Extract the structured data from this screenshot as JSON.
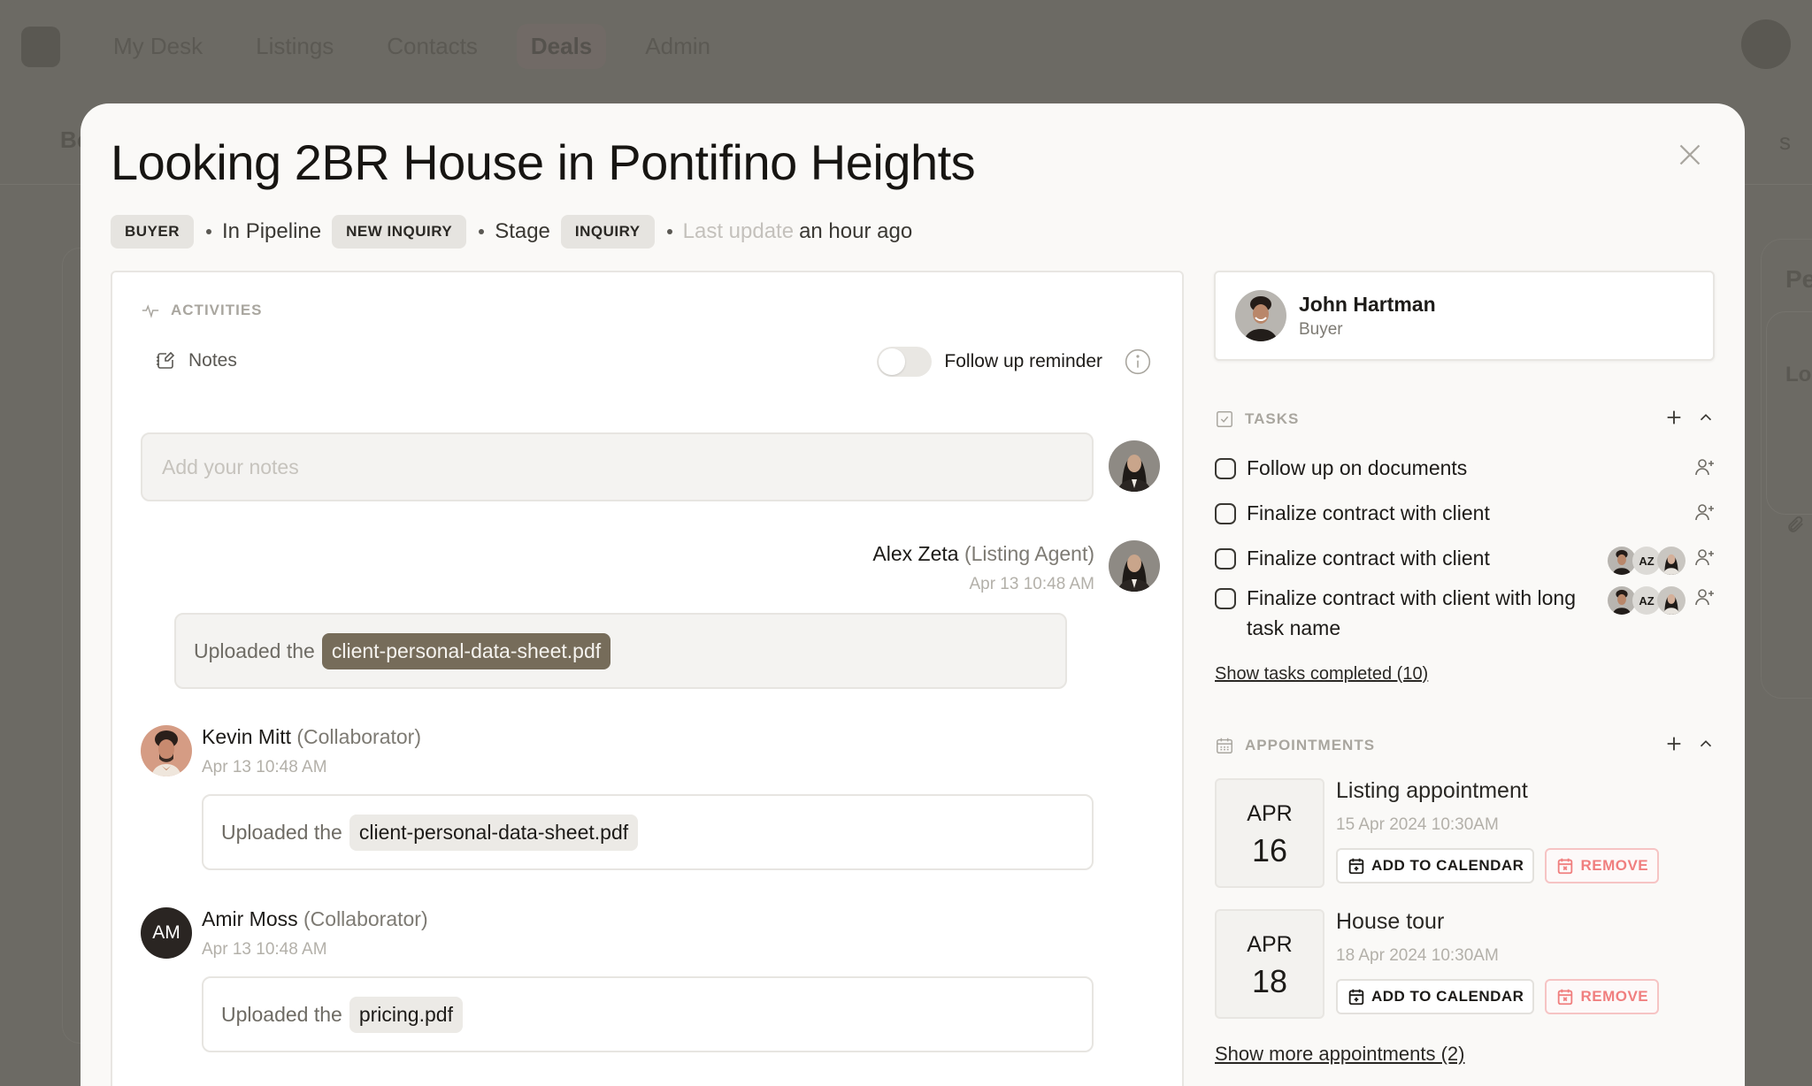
{
  "background_app": {
    "nav_items": [
      {
        "label": "My Desk",
        "active": false
      },
      {
        "label": "Listings",
        "active": false
      },
      {
        "label": "Contacts",
        "active": false
      },
      {
        "label": "Deals",
        "active": true
      },
      {
        "label": "Admin",
        "active": false
      }
    ],
    "subbar_left": "Bo",
    "subbar_right": "s",
    "right_panel_title": "Pe",
    "right_panel_sub": "Lo"
  },
  "modal": {
    "title": "Looking 2BR House in Pontifino Heights",
    "meta": {
      "type_chip": "BUYER",
      "pipeline_label": "In Pipeline",
      "pipeline_chip": "NEW INQUIRY",
      "stage_label": "Stage",
      "stage_chip": "INQUIRY",
      "last_update_label": "Last update",
      "last_update_value": "an hour ago"
    }
  },
  "activities": {
    "heading": "ACTIVITIES",
    "notes_label": "Notes",
    "follow_up_label": "Follow up reminder",
    "follow_up_enabled": false,
    "notes_placeholder": "Add your notes",
    "notes_value": "",
    "feed": [
      {
        "author": "Alex Zeta",
        "role": "(Listing Agent)",
        "time": "Apr 13 10:48 AM",
        "prefix": "Uploaded the",
        "file": "client-personal-data-sheet.pdf",
        "own": true
      },
      {
        "author": "Kevin Mitt",
        "role": "(Collaborator)",
        "time": "Apr 13 10:48 AM",
        "prefix": "Uploaded the",
        "file": "client-personal-data-sheet.pdf",
        "own": false
      },
      {
        "author": "Amir Moss",
        "role": "(Collaborator)",
        "time": "Apr 13 10:48 AM",
        "prefix": "Uploaded the",
        "file": "pricing.pdf",
        "own": false,
        "initials": "AM"
      }
    ]
  },
  "contact": {
    "name": "John Hartman",
    "role": "Buyer"
  },
  "tasks": {
    "heading": "TASKS",
    "items": [
      {
        "label": "Follow up on documents",
        "done": false,
        "assignees": []
      },
      {
        "label": "Finalize contract with client",
        "done": false,
        "assignees": []
      },
      {
        "label": "Finalize contract with client",
        "done": false,
        "assignees": [
          "photo-man",
          "AZ",
          "photo-woman"
        ]
      },
      {
        "label": "Finalize contract with client with long task name",
        "done": false,
        "assignees": [
          "photo-man",
          "AZ",
          "photo-woman"
        ]
      }
    ],
    "assignee_initials": "AZ",
    "show_completed_label": "Show tasks completed (10)"
  },
  "appointments": {
    "heading": "APPOINTMENTS",
    "items": [
      {
        "month": "APR",
        "day": "16",
        "title": "Listing appointment",
        "datetime": "15 Apr 2024 10:30AM"
      },
      {
        "month": "APR",
        "day": "18",
        "title": "House tour",
        "datetime": "18 Apr 2024 10:30AM"
      }
    ],
    "add_to_calendar_label": "ADD TO CALENDAR",
    "remove_label": "REMOVE",
    "show_more_label": "Show more appointments (2)"
  },
  "colors": {
    "overlay": "#6c6a64",
    "modal_bg": "#faf9f7",
    "accent_file_chip": "#766c5a",
    "danger": "#f07f7f"
  }
}
